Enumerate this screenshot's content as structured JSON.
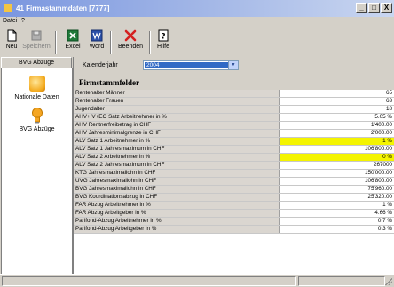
{
  "window": {
    "title": "41 Firmastammdaten [7777]",
    "controls": {
      "minimize": "_",
      "maximize": "□",
      "close": "X"
    }
  },
  "menubar": {
    "items": [
      "Datei",
      "?"
    ]
  },
  "toolbar": {
    "buttons": [
      {
        "label": "Neu",
        "icon": "new-document-icon"
      },
      {
        "label": "Speichern",
        "icon": "save-icon"
      },
      {
        "label": "Excel",
        "icon": "excel-icon"
      },
      {
        "label": "Word",
        "icon": "word-icon"
      },
      {
        "label": "Beenden",
        "icon": "close-x-icon"
      },
      {
        "label": "Hilfe",
        "icon": "help-icon"
      }
    ]
  },
  "sidebar": {
    "header": "BVG Abzüge",
    "items": [
      {
        "label": "Nationale Daten",
        "icon": "folder-icon"
      },
      {
        "label": "BVG Abzüge",
        "icon": "lightbulb-icon"
      }
    ]
  },
  "filter": {
    "label": "Kalenderjahr",
    "value": "2004"
  },
  "section": {
    "title": "Firmstammfelder"
  },
  "rows": [
    {
      "label": "Rentenalter Männer",
      "value": "65",
      "highlight": false
    },
    {
      "label": "Rentenalter Frauen",
      "value": "63",
      "highlight": false
    },
    {
      "label": "Jugendalter",
      "value": "18",
      "highlight": false
    },
    {
      "label": "AHV+IV+EO Satz Arbeitnehmer in %",
      "value": "5.05 %",
      "highlight": false
    },
    {
      "label": "AHV Rentnerfreibetrag in CHF",
      "value": "1'400.00",
      "highlight": false
    },
    {
      "label": "AHV Jahresminimalgrenze in CHF",
      "value": "2'000.00",
      "highlight": false
    },
    {
      "label": "ALV Satz 1 Arbeitnehmer in %",
      "value": "1 %",
      "highlight": true
    },
    {
      "label": "ALV Satz 1 Jahresmaximum in CHF",
      "value": "106'800.00",
      "highlight": false
    },
    {
      "label": "ALV Satz 2 Arbeitnehmer in %",
      "value": "0 %",
      "highlight": true
    },
    {
      "label": "ALV Satz 2 Jahresmaximum in CHF",
      "value": "267000",
      "highlight": false
    },
    {
      "label": "KTG Jahresmaximallohn in CHF",
      "value": "150'000.00",
      "highlight": false
    },
    {
      "label": "UVG Jahresmaximallohn in CHF",
      "value": "106'800.00",
      "highlight": false
    },
    {
      "label": "BVG Jahresmaximallohn in CHF",
      "value": "75'960.00",
      "highlight": false
    },
    {
      "label": "BVG Koordinationsabzug in CHF",
      "value": "25'320.00",
      "highlight": false
    },
    {
      "label": "FAR Abzug Arbeitnehmer in %",
      "value": "1 %",
      "highlight": false
    },
    {
      "label": "FAR Abzug Arbeitgeber in %",
      "value": "4.66 %",
      "highlight": false
    },
    {
      "label": "Parifond-Abzug Arbeitnehmer in %",
      "value": "0.7 %",
      "highlight": false
    },
    {
      "label": "Parifond-Abzug Arbeitgeber in %",
      "value": "0.3 %",
      "highlight": false
    }
  ],
  "colors": {
    "highlight": "#f4f400",
    "selection": "#316ac5",
    "title_gradient_start": "#7a96df"
  }
}
